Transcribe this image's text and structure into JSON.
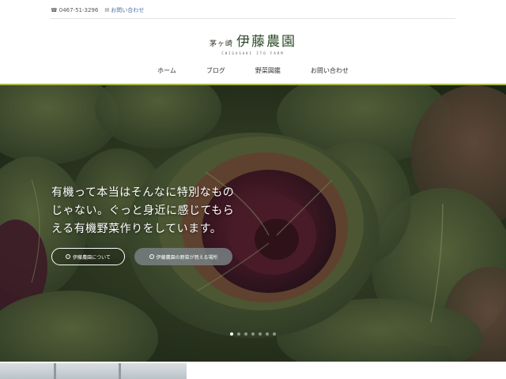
{
  "topbar": {
    "phone_icon": "phone-icon",
    "phone": "0467-51-3296",
    "mail_icon": "mail-icon",
    "contact": "お問い合わせ"
  },
  "logo": {
    "small": "茅ヶ崎",
    "big": "伊藤農園",
    "sub": "CHIGASAKI ITO FARM"
  },
  "nav": {
    "items": [
      "ホーム",
      "ブログ",
      "野菜図鑑",
      "お問い合わせ"
    ]
  },
  "hero": {
    "lines": [
      "有機って本当はそんなに特別なもの",
      "じゃない。ぐっと身近に感じてもら",
      "える有機野菜作りをしています。"
    ],
    "button1": "伊藤農園について",
    "button2": "伊藤農園の野菜が買える場所",
    "slide_count": 7,
    "active_slide": 1
  },
  "colors": {
    "accent_line": "#a9b84a",
    "logo_green": "#6f9a35"
  }
}
